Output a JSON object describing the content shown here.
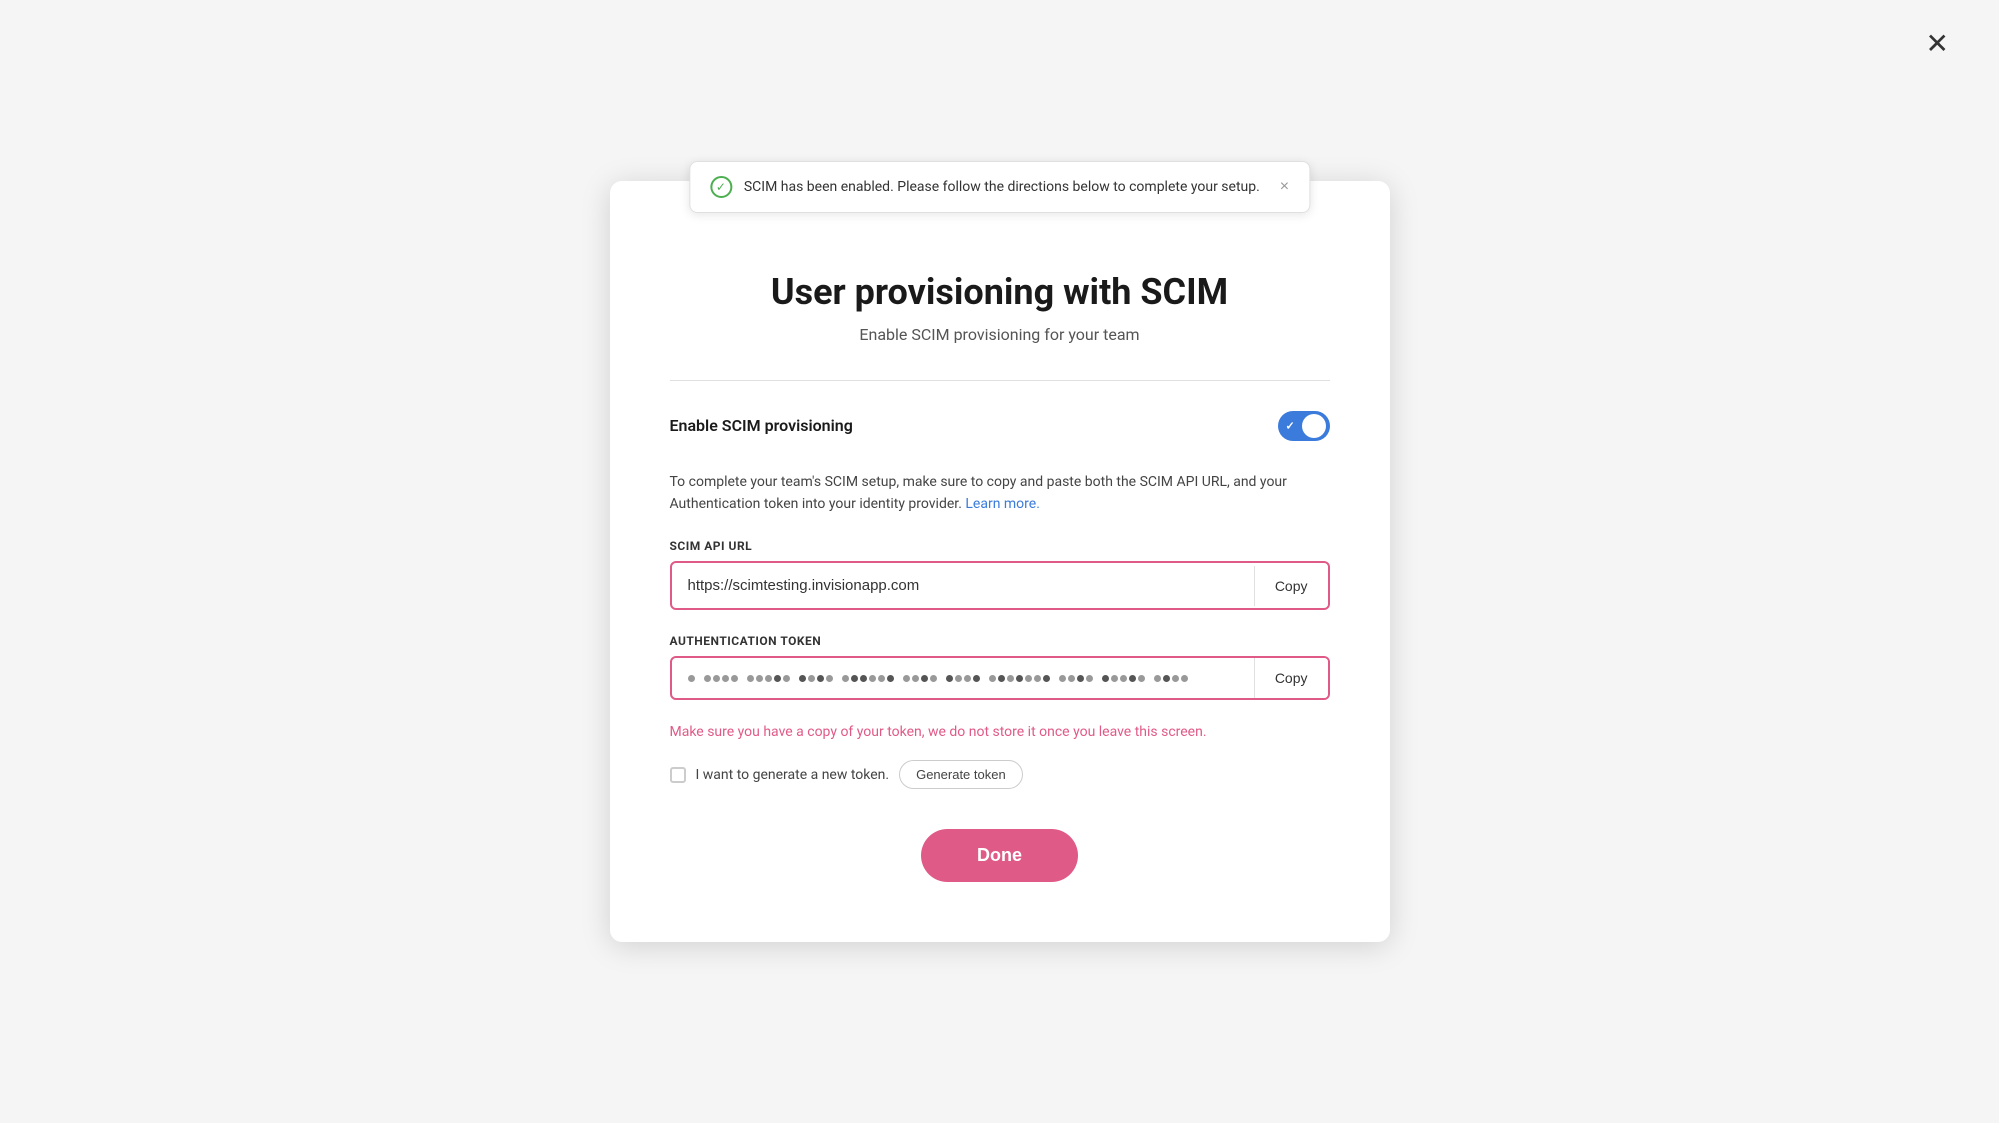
{
  "page": {
    "background": "#f5f5f5"
  },
  "close_button": {
    "label": "✕"
  },
  "toast": {
    "message": "SCIM has been enabled. Please follow the directions below to complete your setup.",
    "close_label": "×"
  },
  "modal": {
    "title": "User provisioning with SCIM",
    "subtitle": "Enable SCIM provisioning for your team",
    "toggle_label": "Enable SCIM provisioning",
    "toggle_on": true,
    "description_part1": "To complete your team's SCIM setup, make sure to copy and paste both the SCIM API URL, and your Authentication token into your identity provider.",
    "learn_more_label": "Learn more.",
    "learn_more_href": "#",
    "scim_api_url_label": "SCIM API URL",
    "scim_api_url_value": "https://scimtesting.invisionapp.com",
    "scim_copy_label": "Copy",
    "auth_token_label": "Authentication token",
    "auth_token_copy_label": "Copy",
    "warning_text": "Make sure you have a copy of your token, we do not store it once you leave this screen.",
    "new_token_checkbox_label": "I want to generate a new token.",
    "generate_token_btn_label": "Generate token",
    "done_btn_label": "Done"
  }
}
